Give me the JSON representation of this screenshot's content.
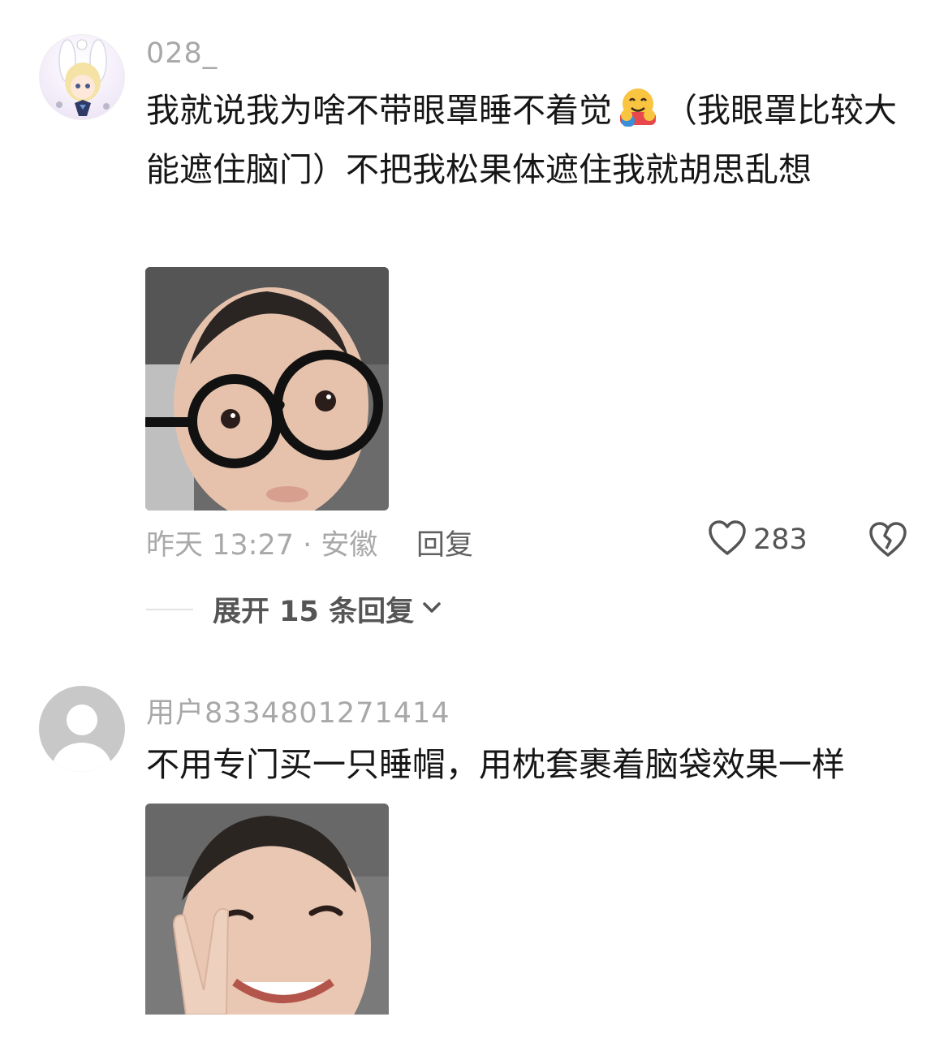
{
  "comments": [
    {
      "username": "028_",
      "text_part1": "我就说我为啥不带眼罩睡不着觉",
      "emoji": "hugging-face",
      "text_part2": "（我眼罩比较大能遮住脑门）不把我松果体遮住我就胡思乱想",
      "time": "昨天 13:27 · 安徽",
      "reply_label": "回复",
      "likes": "283",
      "expand_label": "展开 15 条回复"
    },
    {
      "username": "用户8334801271414",
      "text": "不用专门买一只睡帽，用枕套裹着脑袋效果一样"
    }
  ]
}
